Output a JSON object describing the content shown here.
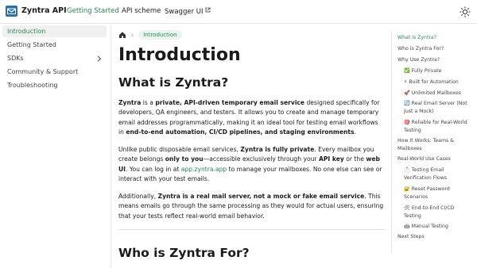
{
  "nav": {
    "brand": "Zyntra API",
    "links": [
      "Getting Started",
      "API scheme",
      "Swagger UI"
    ],
    "accent_color": "#2e8555"
  },
  "sidebar": {
    "items": [
      {
        "label": "Introduction"
      },
      {
        "label": "Getting Started"
      },
      {
        "label": "SDKs"
      },
      {
        "label": "Community & Support"
      },
      {
        "label": "Troubleshooting"
      }
    ]
  },
  "breadcrumb": {
    "current": "Introduction"
  },
  "content": {
    "title": "Introduction",
    "h2_what": "What is Zyntra?",
    "p1": {
      "a": "Zyntra",
      "b": " is a ",
      "c": "private, API-driven temporary email service",
      "d": " designed specifically for developers, QA engineers, and testers. It allows you to create and manage temporary email addresses programmatically, making it an ideal tool for testing email workflows in ",
      "e": "end-to-end automation, CI/CD pipelines, and staging environments",
      "f": "."
    },
    "p2": {
      "a": "Unlike public disposable email services, ",
      "b": "Zyntra is fully private",
      "c": ". Every mailbox you create belongs ",
      "d": "only to you",
      "e": "—accessible exclusively through your ",
      "f": "API key",
      "g": " or the ",
      "h": "web UI",
      "i": ". You can log in at ",
      "link": "app.zyntra.app",
      "j": " to manage your mailboxes. No one else can see or interact with your test emails."
    },
    "p3": {
      "a": "Additionally, ",
      "b": "Zyntra is a real mail server, not a mock or fake email service",
      "c": ". This means emails go through the same processing as they would for actual users, ensuring that your tests reflect real-world email behavior."
    },
    "h2_who": "Who is Zyntra For?"
  },
  "toc": {
    "items": [
      {
        "label": "What is Zyntra?",
        "level": 1
      },
      {
        "label": "Who is Zyntra For?",
        "level": 1
      },
      {
        "label": "Why Use Zyntra?",
        "level": 1
      },
      {
        "label": "✅ Fully Private",
        "level": 2
      },
      {
        "label": "⚡ Built for Automation",
        "level": 2
      },
      {
        "label": "🚀 Unlimited Mailboxes",
        "level": 2
      },
      {
        "label": "🔄 Real Email Server (Not Just a Mock)",
        "level": 2
      },
      {
        "label": "🎯 Reliable for Real-World Testing",
        "level": 2
      },
      {
        "label": "How It Works: Teams & Mailboxes",
        "level": 1
      },
      {
        "label": "Real-World Use Cases",
        "level": 1
      },
      {
        "label": "📩 Testing Email Verification Flows",
        "level": 2
      },
      {
        "label": "🔐 Reset Password Scenarios",
        "level": 2
      },
      {
        "label": "🛠 End-to-End CI/CD Testing",
        "level": 2
      },
      {
        "label": "🤖 Manual Testing",
        "level": 2
      },
      {
        "label": "Next Steps",
        "level": 1
      }
    ]
  }
}
